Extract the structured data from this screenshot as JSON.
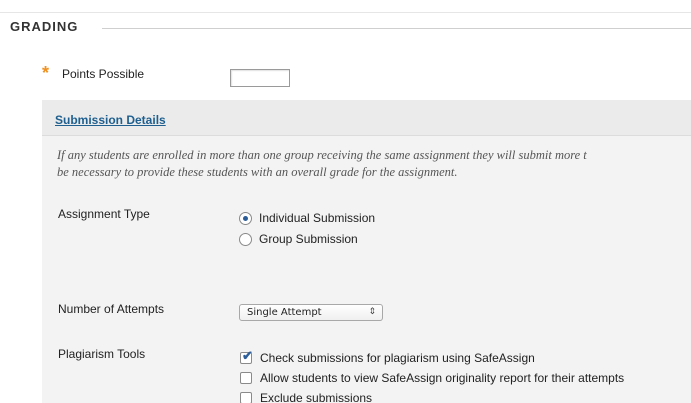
{
  "section": {
    "title": "GRADING"
  },
  "points": {
    "required_marker": "*",
    "label": "Points Possible",
    "value": ""
  },
  "submission_details": {
    "title": "Submission Details",
    "instructions_line1": "If any students are enrolled in more than one group receiving the same assignment they will submit more t",
    "instructions_line2": "be necessary to provide these students with an overall grade for the assignment."
  },
  "assignment_type": {
    "label": "Assignment Type",
    "options": [
      {
        "label": "Individual Submission",
        "selected": true
      },
      {
        "label": "Group Submission",
        "selected": false
      }
    ]
  },
  "attempts": {
    "label": "Number of Attempts",
    "selected": "Single Attempt",
    "arrow_glyph": "⇕"
  },
  "plagiarism": {
    "label": "Plagiarism Tools",
    "options": [
      {
        "label": "Check submissions for plagiarism using SafeAssign",
        "checked": true
      },
      {
        "label": "Allow students to view SafeAssign originality report for their attempts",
        "checked": false
      },
      {
        "label": "Exclude submissions",
        "checked": false
      }
    ]
  },
  "colors": {
    "accent_link": "#1e5f8f",
    "required_star": "#f0901e",
    "panel_bg": "#f3f3f3"
  }
}
